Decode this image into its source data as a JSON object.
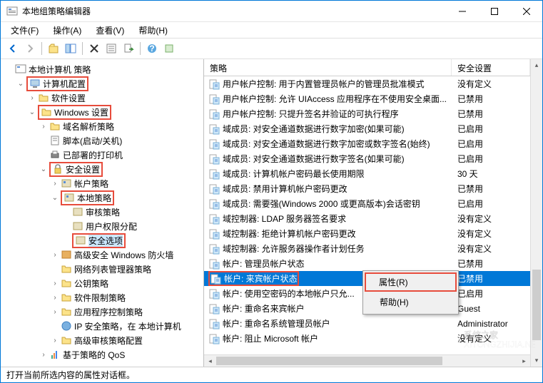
{
  "window": {
    "title": "本地组策略编辑器"
  },
  "menubar": {
    "file": "文件(F)",
    "action": "操作(A)",
    "view": "查看(V)",
    "help": "帮助(H)"
  },
  "tree": {
    "root": "本地计算机 策略",
    "computer_config": "计算机配置",
    "software_settings": "软件设置",
    "windows_settings": "Windows 设置",
    "dns_policy": "域名解析策略",
    "scripts": "脚本(启动/关机)",
    "deployed_printers": "已部署的打印机",
    "security_settings": "安全设置",
    "account_policies": "帐户策略",
    "local_policies": "本地策略",
    "audit_policy": "审核策略",
    "user_rights": "用户权限分配",
    "security_options": "安全选项",
    "firewall": "高级安全 Windows 防火墙",
    "network_list": "网络列表管理器策略",
    "public_key": "公钥策略",
    "software_restriction": "软件限制策略",
    "app_control": "应用程序控制策略",
    "ip_security": "IP 安全策略，在 本地计算机",
    "advanced_audit": "高级审核策略配置",
    "qos": "基于策略的 QoS"
  },
  "list": {
    "headers": {
      "policy": "策略",
      "setting": "安全设置"
    },
    "rows": [
      {
        "policy": "用户帐户控制: 用于内置管理员帐户的管理员批准模式",
        "setting": "没有定义"
      },
      {
        "policy": "用户帐户控制: 允许 UIAccess 应用程序在不使用安全桌面...",
        "setting": "已禁用"
      },
      {
        "policy": "用户帐户控制: 只提升签名并验证的可执行程序",
        "setting": "已禁用"
      },
      {
        "policy": "域成员: 对安全通道数据进行数字加密(如果可能)",
        "setting": "已启用"
      },
      {
        "policy": "域成员: 对安全通道数据进行数字加密或数字签名(始终)",
        "setting": "已启用"
      },
      {
        "policy": "域成员: 对安全通道数据进行数字签名(如果可能)",
        "setting": "已启用"
      },
      {
        "policy": "域成员: 计算机帐户密码最长使用期限",
        "setting": "30 天"
      },
      {
        "policy": "域成员: 禁用计算机帐户密码更改",
        "setting": "已禁用"
      },
      {
        "policy": "域成员: 需要强(Windows 2000 或更高版本)会话密钥",
        "setting": "已启用"
      },
      {
        "policy": "域控制器: LDAP 服务器签名要求",
        "setting": "没有定义"
      },
      {
        "policy": "域控制器: 拒绝计算机帐户密码更改",
        "setting": "没有定义"
      },
      {
        "policy": "域控制器: 允许服务器操作者计划任务",
        "setting": "没有定义"
      },
      {
        "policy": "帐户: 管理员帐户状态",
        "setting": "已禁用"
      },
      {
        "policy": "帐户: 来宾帐户状态",
        "setting": "已禁用",
        "selected": true
      },
      {
        "policy": "帐户: 使用空密码的本地帐户只允...",
        "setting": "已启用"
      },
      {
        "policy": "帐户: 重命名来宾帐户",
        "setting": "Guest"
      },
      {
        "policy": "帐户: 重命名系统管理员帐户",
        "setting": "Administrator"
      },
      {
        "policy": "帐户: 阻止 Microsoft 帐户",
        "setting": "没有定义"
      }
    ]
  },
  "context_menu": {
    "properties": "属性(R)",
    "help": "帮助(H)"
  },
  "statusbar": {
    "text": "打开当前所选内容的属性对话框。"
  },
  "watermark": "系统之家"
}
